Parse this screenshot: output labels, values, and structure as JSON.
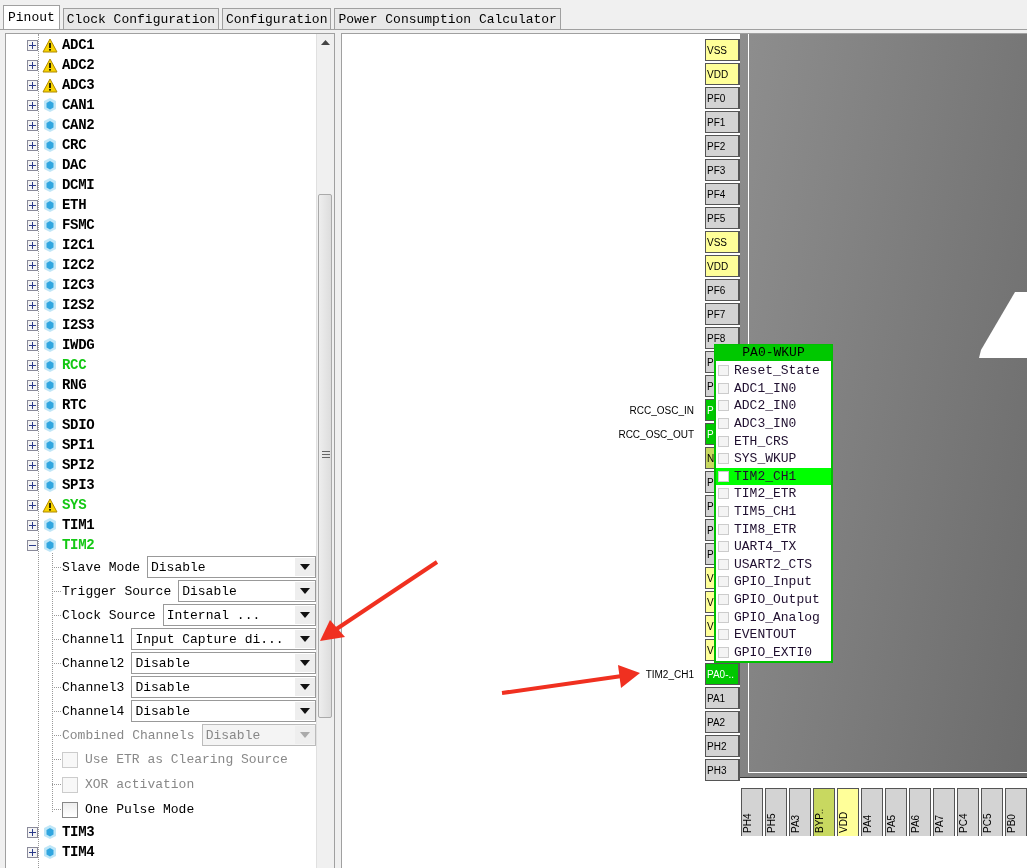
{
  "tabs": [
    {
      "label": "Pinout",
      "selected": true
    },
    {
      "label": "Clock Configuration",
      "selected": false
    },
    {
      "label": "Configuration",
      "selected": false
    },
    {
      "label": "Power Consumption Calculator",
      "selected": false
    }
  ],
  "tree": {
    "items": [
      {
        "label": "ADC1",
        "kind": "warning",
        "configured": false,
        "expanded": false
      },
      {
        "label": "ADC2",
        "kind": "warning",
        "configured": false,
        "expanded": false
      },
      {
        "label": "ADC3",
        "kind": "warning",
        "configured": false,
        "expanded": false
      },
      {
        "label": "CAN1",
        "kind": "peripheral",
        "configured": false,
        "expanded": false
      },
      {
        "label": "CAN2",
        "kind": "peripheral",
        "configured": false,
        "expanded": false
      },
      {
        "label": "CRC",
        "kind": "peripheral",
        "configured": false,
        "expanded": false
      },
      {
        "label": "DAC",
        "kind": "peripheral",
        "configured": false,
        "expanded": false
      },
      {
        "label": "DCMI",
        "kind": "peripheral",
        "configured": false,
        "expanded": false
      },
      {
        "label": "ETH",
        "kind": "peripheral",
        "configured": false,
        "expanded": false
      },
      {
        "label": "FSMC",
        "kind": "peripheral",
        "configured": false,
        "expanded": false
      },
      {
        "label": "I2C1",
        "kind": "peripheral",
        "configured": false,
        "expanded": false
      },
      {
        "label": "I2C2",
        "kind": "peripheral",
        "configured": false,
        "expanded": false
      },
      {
        "label": "I2C3",
        "kind": "peripheral",
        "configured": false,
        "expanded": false
      },
      {
        "label": "I2S2",
        "kind": "peripheral",
        "configured": false,
        "expanded": false
      },
      {
        "label": "I2S3",
        "kind": "peripheral",
        "configured": false,
        "expanded": false
      },
      {
        "label": "IWDG",
        "kind": "peripheral",
        "configured": false,
        "expanded": false
      },
      {
        "label": "RCC",
        "kind": "peripheral",
        "configured": true,
        "expanded": false
      },
      {
        "label": "RNG",
        "kind": "peripheral",
        "configured": false,
        "expanded": false
      },
      {
        "label": "RTC",
        "kind": "peripheral",
        "configured": false,
        "expanded": false
      },
      {
        "label": "SDIO",
        "kind": "peripheral",
        "configured": false,
        "expanded": false
      },
      {
        "label": "SPI1",
        "kind": "peripheral",
        "configured": false,
        "expanded": false
      },
      {
        "label": "SPI2",
        "kind": "peripheral",
        "configured": false,
        "expanded": false
      },
      {
        "label": "SPI3",
        "kind": "peripheral",
        "configured": false,
        "expanded": false
      },
      {
        "label": "SYS",
        "kind": "warning",
        "configured": true,
        "expanded": false
      },
      {
        "label": "TIM1",
        "kind": "peripheral",
        "configured": false,
        "expanded": false
      },
      {
        "label": "TIM2",
        "kind": "peripheral",
        "configured": true,
        "expanded": true,
        "children": [
          {
            "kind": "select",
            "label": "Slave Mode",
            "value": "Disable",
            "disabled": false
          },
          {
            "kind": "select",
            "label": "Trigger Source",
            "value": "Disable",
            "disabled": false
          },
          {
            "kind": "select",
            "label": "Clock Source",
            "value": "Internal ...",
            "disabled": false
          },
          {
            "kind": "select",
            "label": "Channel1",
            "value": "Input Capture di...",
            "disabled": false
          },
          {
            "kind": "select",
            "label": "Channel2",
            "value": "Disable",
            "disabled": false
          },
          {
            "kind": "select",
            "label": "Channel3",
            "value": "Disable",
            "disabled": false
          },
          {
            "kind": "select",
            "label": "Channel4",
            "value": "Disable",
            "disabled": false
          },
          {
            "kind": "select",
            "label": "Combined Channels",
            "value": "Disable",
            "disabled": true
          },
          {
            "kind": "checkbox",
            "label": "Use ETR as Clearing Source",
            "checked": false,
            "disabled": true
          },
          {
            "kind": "checkbox",
            "label": "XOR activation",
            "checked": false,
            "disabled": true
          },
          {
            "kind": "checkbox",
            "label": "One Pulse Mode",
            "checked": false,
            "disabled": false
          }
        ]
      },
      {
        "label": "TIM3",
        "kind": "peripheral",
        "configured": false,
        "expanded": false
      },
      {
        "label": "TIM4",
        "kind": "peripheral",
        "configured": false,
        "expanded": false
      }
    ]
  },
  "pinout": {
    "left_pins": [
      {
        "label": "VSS",
        "kind": "power"
      },
      {
        "label": "VDD",
        "kind": "power"
      },
      {
        "label": "PF0",
        "kind": "io"
      },
      {
        "label": "PF1",
        "kind": "io"
      },
      {
        "label": "PF2",
        "kind": "io"
      },
      {
        "label": "PF3",
        "kind": "io"
      },
      {
        "label": "PF4",
        "kind": "io"
      },
      {
        "label": "PF5",
        "kind": "io"
      },
      {
        "label": "VSS",
        "kind": "power"
      },
      {
        "label": "VDD",
        "kind": "power"
      },
      {
        "label": "PF6",
        "kind": "io"
      },
      {
        "label": "PF7",
        "kind": "io"
      },
      {
        "label": "PF8",
        "kind": "io"
      },
      {
        "label": "P",
        "kind": "io"
      },
      {
        "label": "P",
        "kind": "io"
      },
      {
        "label": "P",
        "kind": "assigned",
        "signal": "RCC_OSC_IN"
      },
      {
        "label": "P",
        "kind": "assigned",
        "signal": "RCC_OSC_OUT"
      },
      {
        "label": "N",
        "kind": "special"
      },
      {
        "label": "P",
        "kind": "io"
      },
      {
        "label": "P",
        "kind": "io"
      },
      {
        "label": "P",
        "kind": "io"
      },
      {
        "label": "P",
        "kind": "io"
      },
      {
        "label": "V",
        "kind": "power"
      },
      {
        "label": "V",
        "kind": "power"
      },
      {
        "label": "V",
        "kind": "power"
      },
      {
        "label": "V",
        "kind": "power"
      },
      {
        "label": "PA0-..",
        "kind": "assigned",
        "signal": "TIM2_CH1"
      },
      {
        "label": "PA1",
        "kind": "io"
      },
      {
        "label": "PA2",
        "kind": "io"
      },
      {
        "label": "PH2",
        "kind": "io"
      },
      {
        "label": "PH3",
        "kind": "io"
      }
    ],
    "bottom_pins": [
      {
        "label": "PH4",
        "kind": "io"
      },
      {
        "label": "PH5",
        "kind": "io"
      },
      {
        "label": "PA3",
        "kind": "io"
      },
      {
        "label": "BYP..",
        "kind": "special"
      },
      {
        "label": "VDD",
        "kind": "power"
      },
      {
        "label": "PA4",
        "kind": "io"
      },
      {
        "label": "PA5",
        "kind": "io"
      },
      {
        "label": "PA6",
        "kind": "io"
      },
      {
        "label": "PA7",
        "kind": "io"
      },
      {
        "label": "PC4",
        "kind": "io"
      },
      {
        "label": "PC5",
        "kind": "io"
      },
      {
        "label": "PB0",
        "kind": "io"
      }
    ],
    "menu": {
      "title": "PA0-WKUP",
      "items": [
        {
          "label": "Reset_State",
          "selected": false,
          "checked": false
        },
        {
          "label": "ADC1_IN0",
          "selected": false,
          "checked": false
        },
        {
          "label": "ADC2_IN0",
          "selected": false,
          "checked": false
        },
        {
          "label": "ADC3_IN0",
          "selected": false,
          "checked": false
        },
        {
          "label": "ETH_CRS",
          "selected": false,
          "checked": false
        },
        {
          "label": "SYS_WKUP",
          "selected": false,
          "checked": false
        },
        {
          "label": "TIM2_CH1",
          "selected": true,
          "checked": false
        },
        {
          "label": "TIM2_ETR",
          "selected": false,
          "checked": false
        },
        {
          "label": "TIM5_CH1",
          "selected": false,
          "checked": false
        },
        {
          "label": "TIM8_ETR",
          "selected": false,
          "checked": false
        },
        {
          "label": "UART4_TX",
          "selected": false,
          "checked": false
        },
        {
          "label": "USART2_CTS",
          "selected": false,
          "checked": false
        },
        {
          "label": "GPIO_Input",
          "selected": false,
          "checked": false
        },
        {
          "label": "GPIO_Output",
          "selected": false,
          "checked": false
        },
        {
          "label": "GPIO_Analog",
          "selected": false,
          "checked": false
        },
        {
          "label": "EVENTOUT",
          "selected": false,
          "checked": false
        },
        {
          "label": "GPIO_EXTI0",
          "selected": false,
          "checked": false
        }
      ]
    }
  }
}
